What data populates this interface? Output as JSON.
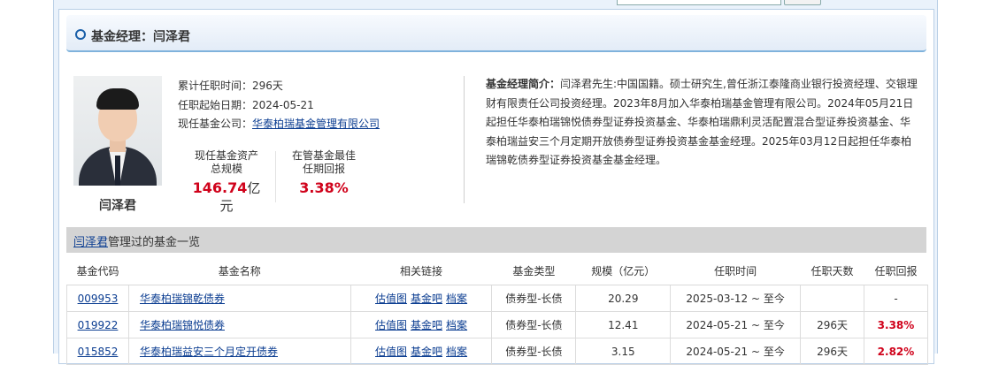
{
  "title": "基金经理：闫泽君",
  "manager": {
    "name": "闫泽君",
    "tenure_label": "累计任职时间：",
    "tenure_value": "296天",
    "start_label": "任职起始日期：",
    "start_value": "2024-05-21",
    "company_label": "现任基金公司：",
    "company_value": "华泰柏瑞基金管理有限公司"
  },
  "stats": {
    "assets_label_1": "现任基金资产",
    "assets_label_2": "总规模",
    "assets_value": "146.74",
    "assets_unit": "亿元",
    "return_label_1": "在管基金最佳",
    "return_label_2": "任期回报",
    "return_value": "3.38%"
  },
  "intro": {
    "label": "基金经理简介：",
    "text": "闫泽君先生:中国国籍。硕士研究生,曾任浙江泰隆商业银行投资经理、交银理财有限责任公司投资经理。2023年8月加入华泰柏瑞基金管理有限公司。2024年05月21日起担任华泰柏瑞锦悦债券型证券投资基金、华泰柏瑞鼎利灵活配置混合型证券投资基金、华泰柏瑞益安三个月定期开放债券型证券投资基金基金经理。2025年03月12日起担任华泰柏瑞锦乾债券型证券投资基金基金经理。"
  },
  "list": {
    "name_link": "闫泽君",
    "title_suffix": "管理过的基金一览",
    "headers": [
      "基金代码",
      "基金名称",
      "相关链接",
      "基金类型",
      "规模（亿元）",
      "任职时间",
      "任职天数",
      "任职回报"
    ],
    "link_labels": [
      "估值图",
      "基金吧",
      "档案"
    ],
    "rows": [
      {
        "code": "009953",
        "name": "华泰柏瑞锦乾债券",
        "type": "债券型-长债",
        "size": "20.29",
        "period": "2025-03-12 ~ 至今",
        "days": "",
        "return": "-"
      },
      {
        "code": "019922",
        "name": "华泰柏瑞锦悦债券",
        "type": "债券型-长债",
        "size": "12.41",
        "period": "2024-05-21 ~ 至今",
        "days": "296天",
        "return": "3.38%"
      },
      {
        "code": "015852",
        "name": "华泰柏瑞益安三个月定开债券",
        "type": "债券型-长债",
        "size": "3.15",
        "period": "2024-05-21 ~ 至今",
        "days": "296天",
        "return": "2.82%"
      }
    ]
  },
  "colors": {
    "accent": "#1a5fa8",
    "highlight_red": "#d0021b",
    "link": "#0b3d91"
  }
}
